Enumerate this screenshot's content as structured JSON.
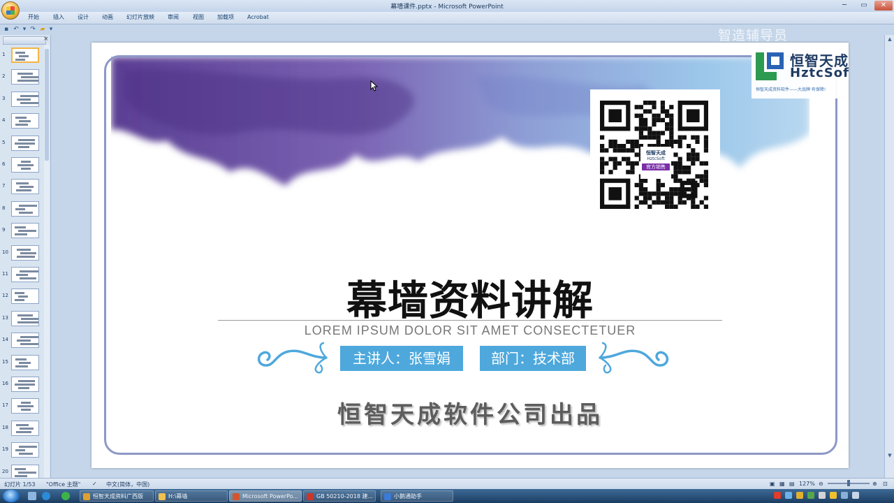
{
  "window": {
    "title": "幕墙课件.pptx - Microsoft PowerPoint",
    "min_glyph": "─",
    "max_glyph": "▭",
    "close_glyph": "✕"
  },
  "ribbon": {
    "tabs": [
      "开始",
      "插入",
      "设计",
      "动画",
      "幻灯片放映",
      "审阅",
      "视图",
      "加载项",
      "Acrobat"
    ]
  },
  "overlay": {
    "watermark": "智造辅导员"
  },
  "slide_panel": {
    "close_glyph": "×",
    "numbers": [
      "1",
      "2",
      "3",
      "4",
      "5",
      "6",
      "7",
      "8",
      "9",
      "10",
      "11",
      "12",
      "13",
      "14",
      "15",
      "16",
      "17",
      "18",
      "19",
      "20"
    ]
  },
  "slide": {
    "logo": {
      "cn": "恒智天成",
      "en": "HztcSoft",
      "slogan": "恒智天成资料软件——大品牌·有保障!"
    },
    "qr": {
      "center_label_1": "恒智天成",
      "center_label_2": "HztcSoft",
      "center_badge": "官方销售"
    },
    "title": "幕墙资料讲解",
    "subtitle": "LOREM IPSUM DOLOR SIT AMET CONSECTETUER",
    "speaker": "主讲人：张雪娟",
    "department": "部门：技术部",
    "company": "恒智天成软件公司出品"
  },
  "status_bar": {
    "slide_counter": "幻灯片 1/53",
    "theme": "\"Office 主题\"",
    "language": "中文(简体，中国)",
    "zoom": "127%"
  },
  "taskbar": {
    "items": [
      {
        "label": "恒智天成资料广西版",
        "color": "#e0a030"
      },
      {
        "label": "H:\\幕墙",
        "color": "#f0c050"
      },
      {
        "label": "Microsoft PowerPo...",
        "color": "#d2552f"
      },
      {
        "label": "GB 50210-2018 建...",
        "color": "#c9372c"
      },
      {
        "label": "小鹅通助手",
        "color": "#3b7bd8"
      }
    ]
  },
  "colors": {
    "accent_blue": "#4ea8dc",
    "frame": "#8d98c6",
    "ink_purple": "#6a4e9e",
    "ink_blue": "#8ab6e0"
  }
}
